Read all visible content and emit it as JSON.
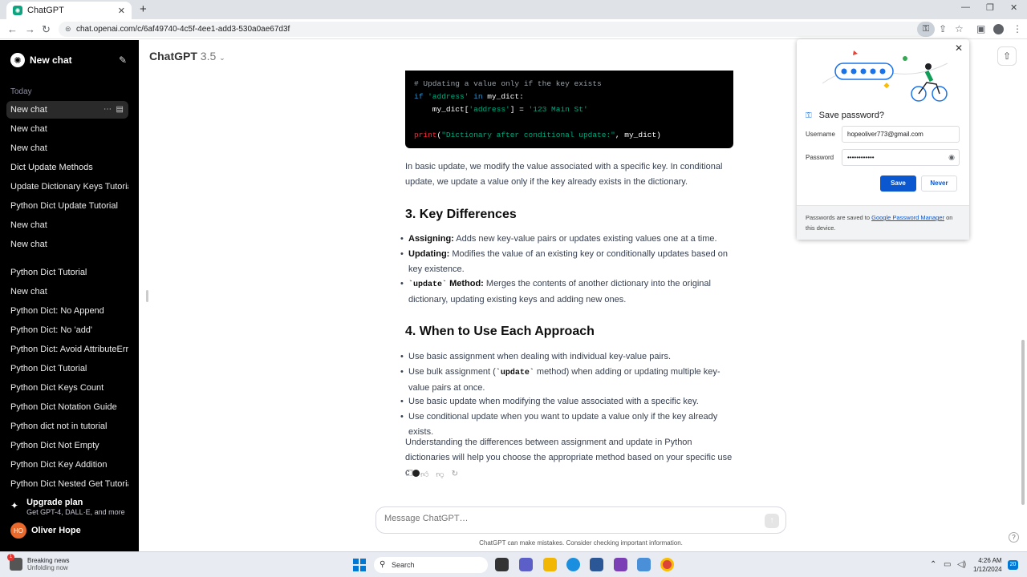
{
  "browser": {
    "tab_title": "ChatGPT",
    "tab_close": "✕",
    "new_tab": "+",
    "url": "chat.openai.com/c/6af49740-4c5f-4ee1-add3-530a0ae67d3f",
    "nav": {
      "back": "←",
      "forward": "→",
      "reload": "↻"
    }
  },
  "sidebar": {
    "new_chat": "New chat",
    "section_today": "Today",
    "items": [
      "New chat",
      "New chat",
      "New chat",
      "Dict Update Methods",
      "Update Dictionary Keys Tutorial",
      "Python Dict Update Tutorial",
      "New chat",
      "New chat",
      "Python Dict Tutorial",
      "New chat",
      "Python Dict: No Append",
      "Python Dict: No 'add'",
      "Python Dict: Avoid AttributeError",
      "Python Dict Tutorial",
      "Python Dict Keys Count",
      "Python Dict Notation Guide",
      "Python dict not in tutorial",
      "Python Dict Not Empty",
      "Python Dict Key Addition",
      "Python Dict Nested Get Tutorial"
    ],
    "upgrade_title": "Upgrade plan",
    "upgrade_sub": "Get GPT-4, DALL·E, and more",
    "user_initials": "HO",
    "user_name": "Oliver Hope"
  },
  "header": {
    "model": "ChatGPT",
    "version": "3.5"
  },
  "code_lines": {
    "l1": "# Updating a value only if the key exists",
    "l2_kw": "if",
    "l2_str": "'address'",
    "l2_in": "in",
    "l2_rest": "my_dict:",
    "l3_a": "    my_dict[",
    "l3_str": "'address'",
    "l3_b": "] = ",
    "l3_val": "'123 Main St'",
    "l4_fn": "print",
    "l4_a": "(",
    "l4_str": "\"Dictionary after conditional update:\"",
    "l4_b": ", my_dict)"
  },
  "content": {
    "para1": "In basic update, we modify the value associated with a specific key. In conditional update, we update a value only if the key already exists in the dictionary.",
    "h_key_diff": "3. Key Differences",
    "kd1_b": "Assigning:",
    "kd1": " Adds new key-value pairs or updates existing values one at a time.",
    "kd2_b": "Updating:",
    "kd2": " Modifies the value of an existing key or conditionally updates based on key existence.",
    "kd3_code": "`update`",
    "kd3_b": " Method:",
    "kd3": " Merges the contents of another dictionary into the original dictionary, updating existing keys and adding new ones.",
    "h_when": "4. When to Use Each Approach",
    "w1": "Use basic assignment when dealing with individual key-value pairs.",
    "w2_a": "Use bulk assignment (",
    "w2_code": "`update`",
    "w2_b": " method) when adding or updating multiple key-value pairs at once.",
    "w3": "Use basic update when modifying the value associated with a specific key.",
    "w4": "Use conditional update when you want to update a value only if the key already exists.",
    "para2": "Understanding the differences between assignment and update in Python dictionaries will help you choose the appropriate method based on your specific use c"
  },
  "composer": {
    "placeholder": "Message ChatGPT…",
    "disclaimer": "ChatGPT can make mistakes. Consider checking important information.",
    "help": "?"
  },
  "password_popup": {
    "title": "Save password?",
    "username_label": "Username",
    "username_value": "hopeoliver773@gmail.com",
    "password_label": "Password",
    "password_value": "••••••••••••",
    "save": "Save",
    "never": "Never",
    "footer_a": "Passwords are saved to ",
    "footer_link": "Google Password Manager",
    "footer_b": " on this device.",
    "close": "✕"
  },
  "taskbar": {
    "news_badge": "1",
    "news_title": "Breaking news",
    "news_sub": "Unfolding now",
    "search": "Search",
    "time": "4:26 AM",
    "date": "1/12/2024",
    "notif_count": "20"
  },
  "colors": {
    "sidebar_bg": "#000000",
    "save_button": "#0b57d0",
    "user_avatar": "#e8692b"
  }
}
